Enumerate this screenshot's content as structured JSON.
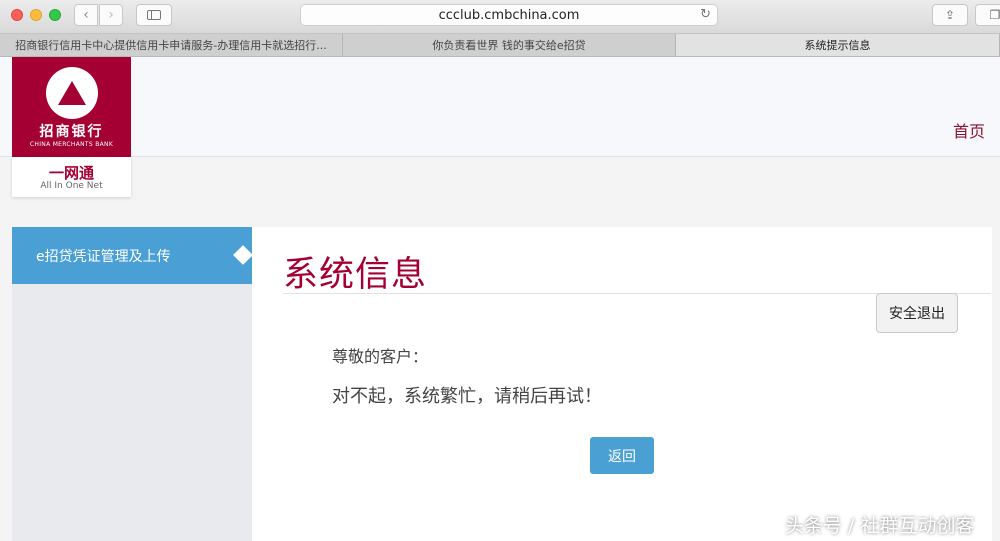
{
  "browser": {
    "url": "ccclub.cmbchina.com",
    "tabs": [
      {
        "label": "招商银行信用卡中心提供信用卡申请服务-办理信用卡就选招行..."
      },
      {
        "label": "你负责看世界 钱的事交给e招贷"
      },
      {
        "label": "系统提示信息"
      }
    ]
  },
  "header": {
    "bank_name_cn": "招商银行",
    "bank_name_en": "CHINA MERCHANTS BANK",
    "portal_cn": "一网通",
    "portal_en": "All In One Net",
    "home_link": "首页"
  },
  "sidebar": {
    "active_item": "e招贷凭证管理及上传"
  },
  "main": {
    "title": "系统信息",
    "logout_label": "安全退出",
    "greeting": "尊敬的客户：",
    "message": "对不起，系统繁忙，请稍后再试！",
    "back_label": "返回"
  },
  "watermark": "头条号 / 社群互动创客",
  "colors": {
    "brand": "#a40034",
    "accent_blue": "#4a9fd5"
  }
}
